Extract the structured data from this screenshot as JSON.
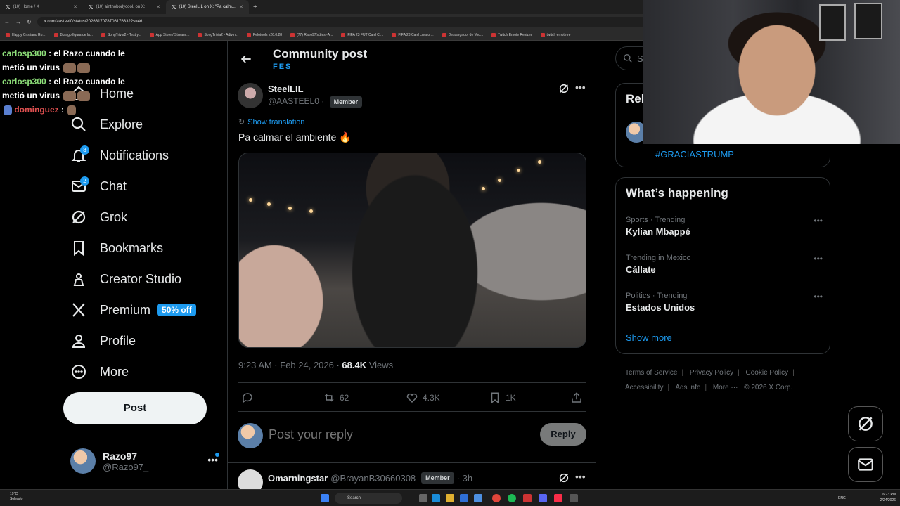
{
  "browser": {
    "tabs": [
      {
        "title": "(10) Home / X",
        "active": false
      },
      {
        "title": "(10) aintnobodycool. on X:",
        "active": false
      },
      {
        "title": "(10) SteelLIL on X: \"Pa calm...",
        "active": true
      }
    ],
    "url": "x.com/aasteel0/status/2026317078706176332?s=46",
    "bookmarks": [
      "Happy Cristiano Ro...",
      "Burago figura de la...",
      "SongTrivia2 - Test y...",
      "App Store / Streami...",
      "SongTrivia2 - Adivin...",
      "Pelotools v26.0.28",
      "(77) Razo97's Zest-A...",
      "FIFA 23 FUT Card Cr...",
      "FIFA 23 Card creator...",
      "Descargador de You...",
      "Twitch Emote Resizer",
      "twitch emote re"
    ]
  },
  "chat": [
    {
      "user": "carlosp300",
      "message": ": el Razo cuando le metió un virus"
    },
    {
      "user": "carlosp300",
      "message": ": el Razo cuando le metió un virus"
    },
    {
      "user": "dominguez",
      "message": ":"
    }
  ],
  "nav": {
    "items": [
      {
        "label": "Home",
        "icon": "home-icon"
      },
      {
        "label": "Explore",
        "icon": "search-icon"
      },
      {
        "label": "Notifications",
        "icon": "bell-icon",
        "badge": "8"
      },
      {
        "label": "Chat",
        "icon": "mail-icon",
        "badge": "2"
      },
      {
        "label": "Grok",
        "icon": "grok-icon"
      },
      {
        "label": "Bookmarks",
        "icon": "bookmark-icon"
      },
      {
        "label": "Creator Studio",
        "icon": "creator-studio-icon"
      },
      {
        "label": "Premium",
        "icon": "x-logo-icon",
        "offer": "50% off"
      },
      {
        "label": "Profile",
        "icon": "person-icon"
      },
      {
        "label": "More",
        "icon": "more-circle-icon"
      }
    ],
    "post_button": "Post",
    "account": {
      "name": "Razo97",
      "handle": "@Razo97_"
    }
  },
  "main": {
    "title": "Community post",
    "community": "FES",
    "post": {
      "author_name": "SteelLIL",
      "author_handle": "@AASTEEL0",
      "separator": "·",
      "badge": "Member",
      "translate": "Show translation",
      "text": "Pa calmar el ambiente 🔥",
      "time": "9:23 AM · Feb 24, 2026 · ",
      "views_count": "68.4K",
      "views_label": " Views",
      "replies": "",
      "reposts": "62",
      "likes": "4.3K",
      "bookmarks": "1K"
    },
    "reply_placeholder": "Post your reply",
    "reply_button": "Reply",
    "next_reply": {
      "name": "Omarningstar",
      "handle": "@BrayanB30660308",
      "badge": "Member",
      "time": "· 3h"
    }
  },
  "right": {
    "search_placeholder": "Se",
    "relevant_title": "Rel",
    "relevant_tag": "#GRACIASTRUMP",
    "trends_title": "What’s happening",
    "trends": [
      {
        "context": "Sports · Trending",
        "name": "Kylian Mbappé"
      },
      {
        "context": "Trending in Mexico",
        "name": "Cállate"
      },
      {
        "context": "Politics · Trending",
        "name": "Estados Unidos"
      }
    ],
    "show_more": "Show more",
    "footer": [
      "Terms of Service",
      "Privacy Policy",
      "Cookie Policy",
      "Accessibility",
      "Ads info",
      "More ···",
      "© 2026 X Corp."
    ]
  },
  "taskbar": {
    "weather_temp": "19°C",
    "weather_desc": "Soleado",
    "search": "Search",
    "lang": "ENG",
    "time": "6:23 PM",
    "date": "2/24/2026"
  },
  "colors": {
    "accent": "#1d9bf0",
    "background": "#000000",
    "border": "#2f3336",
    "muted": "#71767b"
  }
}
